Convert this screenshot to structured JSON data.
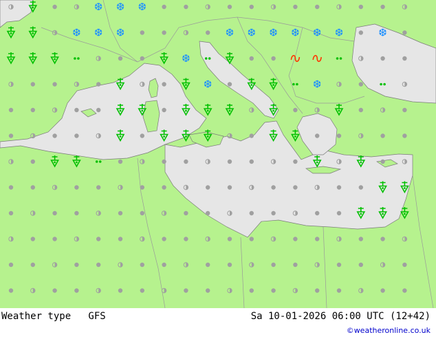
{
  "header": {
    "title": "Weather type   GFS",
    "timestamp": "Sa 10-01-2026 06:00 UTC (12+42)",
    "credit": "©weatheronline.co.uk"
  },
  "colors": {
    "land": "#b6f28e",
    "sea": "#e6e6e6",
    "border": "#9a9a9a",
    "coast": "#7a7a7a",
    "rain": "#00c000",
    "snow": "#1e90ff",
    "freezing": "#ff3300",
    "dry": "#a0a0a0"
  },
  "legend_symbols": [
    "dry-cloud",
    "partly-cloudy",
    "rain-shower",
    "drizzle",
    "snow",
    "freezing-rain"
  ]
}
